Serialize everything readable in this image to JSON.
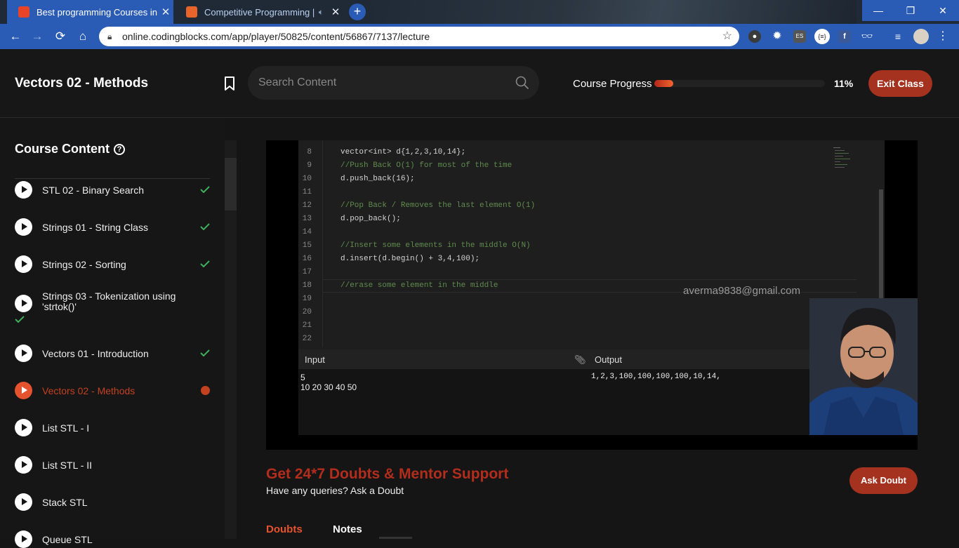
{
  "browser": {
    "tabs": [
      {
        "title": "Best programming Courses in De",
        "active": true,
        "favicon_color": "#e8442a"
      },
      {
        "title": "Competitive Programming | ",
        "active": false,
        "favicon_color": "#e8642a"
      }
    ],
    "new_tab_label": "+",
    "url": "online.codingblocks.com/app/player/50825/content/56867/7137/lecture",
    "window_buttons": {
      "minimize": "—",
      "restore": "❐",
      "close": "✕"
    },
    "extensions": [
      "ninja-extension-icon",
      "gear-extension-icon",
      "es-extension-icon",
      "json-extension-icon",
      "facebook-extension-icon",
      "glasses-extension-icon",
      "playlist-extension-icon",
      "profile-avatar",
      "menu-icon"
    ],
    "ext_es_label": "ES",
    "ext_json_label": "{≡}",
    "ext_fb_label": "f"
  },
  "header": {
    "lecture_title": "Vectors 02 - Methods",
    "search_placeholder": "Search Content",
    "progress_label": "Course Progress",
    "progress_percent": "11%",
    "progress_value": 0.11,
    "exit_label": "Exit Class"
  },
  "sidebar": {
    "title": "Course Content",
    "help_label": "?",
    "items": [
      {
        "label": "STL 02 - Binary Search",
        "status": "done"
      },
      {
        "label": "Strings 01 - String Class",
        "status": "done"
      },
      {
        "label": "Strings 02 - Sorting",
        "status": "done"
      },
      {
        "label": "Strings 03 - Tokenization using 'strtok()'",
        "line1": "Strings 03 - Tokenization using",
        "line2": "'strtok()'",
        "status": "done"
      },
      {
        "label": "Vectors 01 - Introduction",
        "status": "done"
      },
      {
        "label": "Vectors 02 - Methods",
        "status": "current"
      },
      {
        "label": "List STL - I",
        "status": "none"
      },
      {
        "label": "List STL - II",
        "status": "none"
      },
      {
        "label": "Stack STL",
        "status": "none"
      },
      {
        "label": "Queue STL",
        "status": "none"
      }
    ]
  },
  "video": {
    "code_lines": [
      {
        "num": "8",
        "text": "vector<int> d{1,2,3,10,14};"
      },
      {
        "num": "9",
        "text": "//Push Back O(1) for most of the time"
      },
      {
        "num": "10",
        "text": "d.push_back(16);"
      },
      {
        "num": "11",
        "text": ""
      },
      {
        "num": "12",
        "text": "//Pop Back / Removes the last element O(1)"
      },
      {
        "num": "13",
        "text": "d.pop_back();"
      },
      {
        "num": "14",
        "text": ""
      },
      {
        "num": "15",
        "text": "//Insert some elements in the middle O(N)"
      },
      {
        "num": "16",
        "text": "d.insert(d.begin() + 3,4,100);"
      },
      {
        "num": "17",
        "text": ""
      },
      {
        "num": "18",
        "text": "//erase some element in the middle"
      },
      {
        "num": "19",
        "text": ""
      },
      {
        "num": "20",
        "text": ""
      },
      {
        "num": "21",
        "text": ""
      },
      {
        "num": "22",
        "text": ""
      }
    ],
    "watermark": "averma9838@gmail.com",
    "input_label": "Input",
    "output_label": "Output",
    "input_value": "5\n10 20 30 40 50",
    "output_value": "1,2,3,100,100,100,100,10,14,"
  },
  "doubts": {
    "title": "Get 24*7 Doubts & Mentor Support",
    "subtitle": "Have any queries? Ask a Doubt",
    "ask_label": "Ask Doubt"
  },
  "content_tabs": {
    "doubts": "Doubts",
    "notes": "Notes"
  }
}
